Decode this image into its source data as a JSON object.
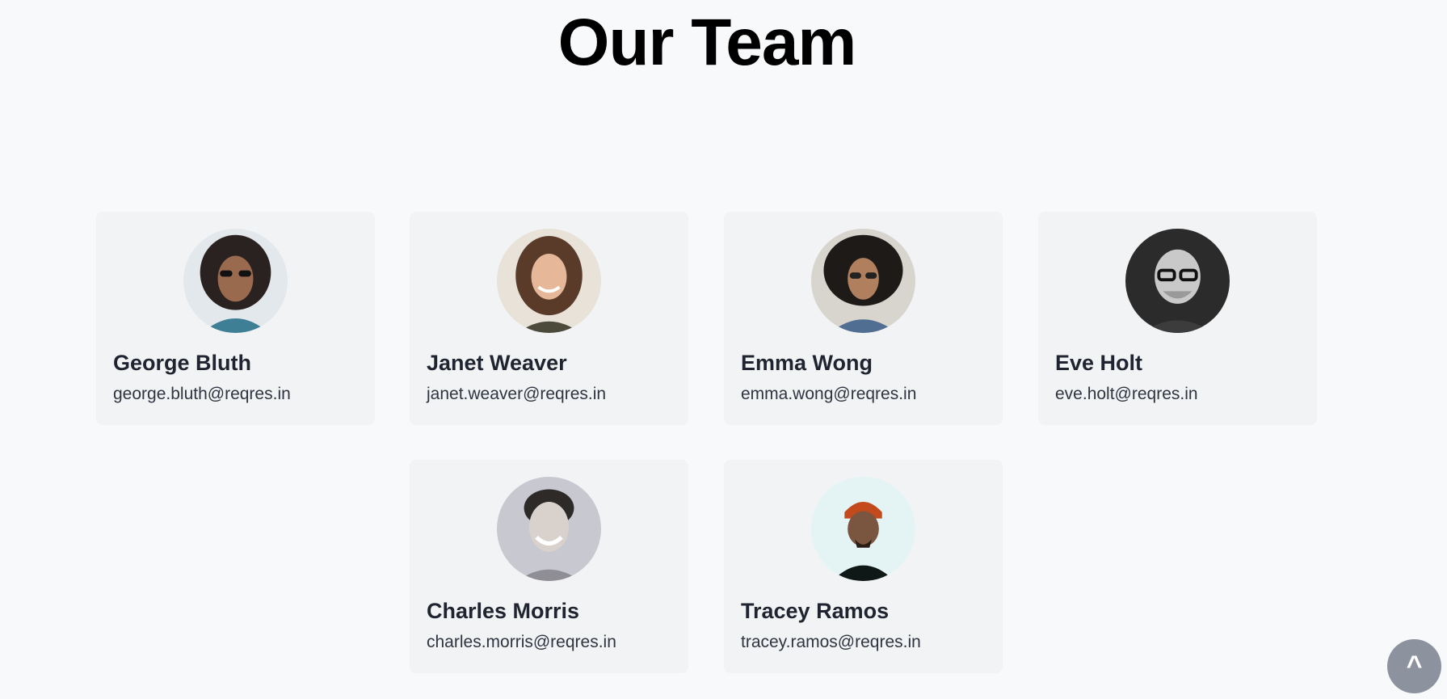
{
  "page": {
    "title": "Our Team"
  },
  "members": [
    {
      "name": "George Bluth",
      "email": "george.bluth@reqres.in",
      "avatar_desc": "avatar-photo"
    },
    {
      "name": "Janet Weaver",
      "email": "janet.weaver@reqres.in",
      "avatar_desc": "avatar-photo"
    },
    {
      "name": "Emma Wong",
      "email": "emma.wong@reqres.in",
      "avatar_desc": "avatar-photo"
    },
    {
      "name": "Eve Holt",
      "email": "eve.holt@reqres.in",
      "avatar_desc": "avatar-photo"
    },
    {
      "name": "Charles Morris",
      "email": "charles.morris@reqres.in",
      "avatar_desc": "avatar-photo"
    },
    {
      "name": "Tracey Ramos",
      "email": "tracey.ramos@reqres.in",
      "avatar_desc": "avatar-photo"
    }
  ],
  "scroll_top": {
    "label": "^"
  },
  "colors": {
    "background": "#f8f9fb",
    "card": "#f2f3f5",
    "scroll_button": "#8d939e"
  }
}
